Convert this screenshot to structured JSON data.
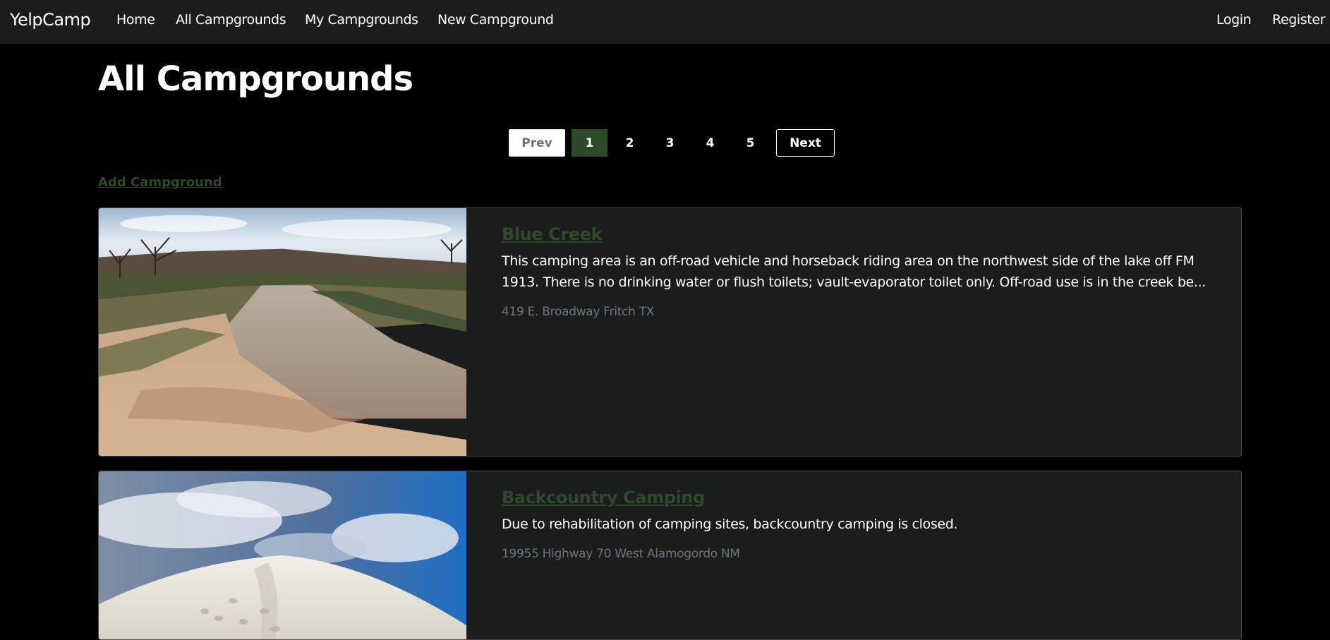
{
  "navbar": {
    "brand": "YelpCamp",
    "links": [
      {
        "label": "Home"
      },
      {
        "label": "All Campgrounds"
      },
      {
        "label": "My Campgrounds"
      },
      {
        "label": "New Campground"
      }
    ],
    "auth": [
      {
        "label": "Login"
      },
      {
        "label": "Register"
      }
    ]
  },
  "page": {
    "title": "All Campgrounds",
    "add_link": "Add Campground"
  },
  "pagination": {
    "prev": "Prev",
    "next": "Next",
    "pages": [
      "1",
      "2",
      "3",
      "4",
      "5"
    ],
    "current": "1"
  },
  "campgrounds": [
    {
      "title": "Blue Creek",
      "description": "This camping area is an off-road vehicle and horseback riding area on the northwest side of the lake off FM 1913. There is no drinking water or flush toilets; vault-evaporator toilet only. Off-road use is in the creek be...",
      "location": "419 E. Broadway Fritch TX"
    },
    {
      "title": "Backcountry Camping",
      "description": "Due to rehabilitation of camping sites, backcountry camping is closed.",
      "location": "19955 Highway 70 West Alamogordo NM"
    }
  ],
  "colors": {
    "navbar_bg": "#1b1d1d",
    "card_bg": "#1b1d1d",
    "accent_green": "#2e4a2a",
    "active_page": "#2c4a2a",
    "muted_text": "#6c757d"
  }
}
